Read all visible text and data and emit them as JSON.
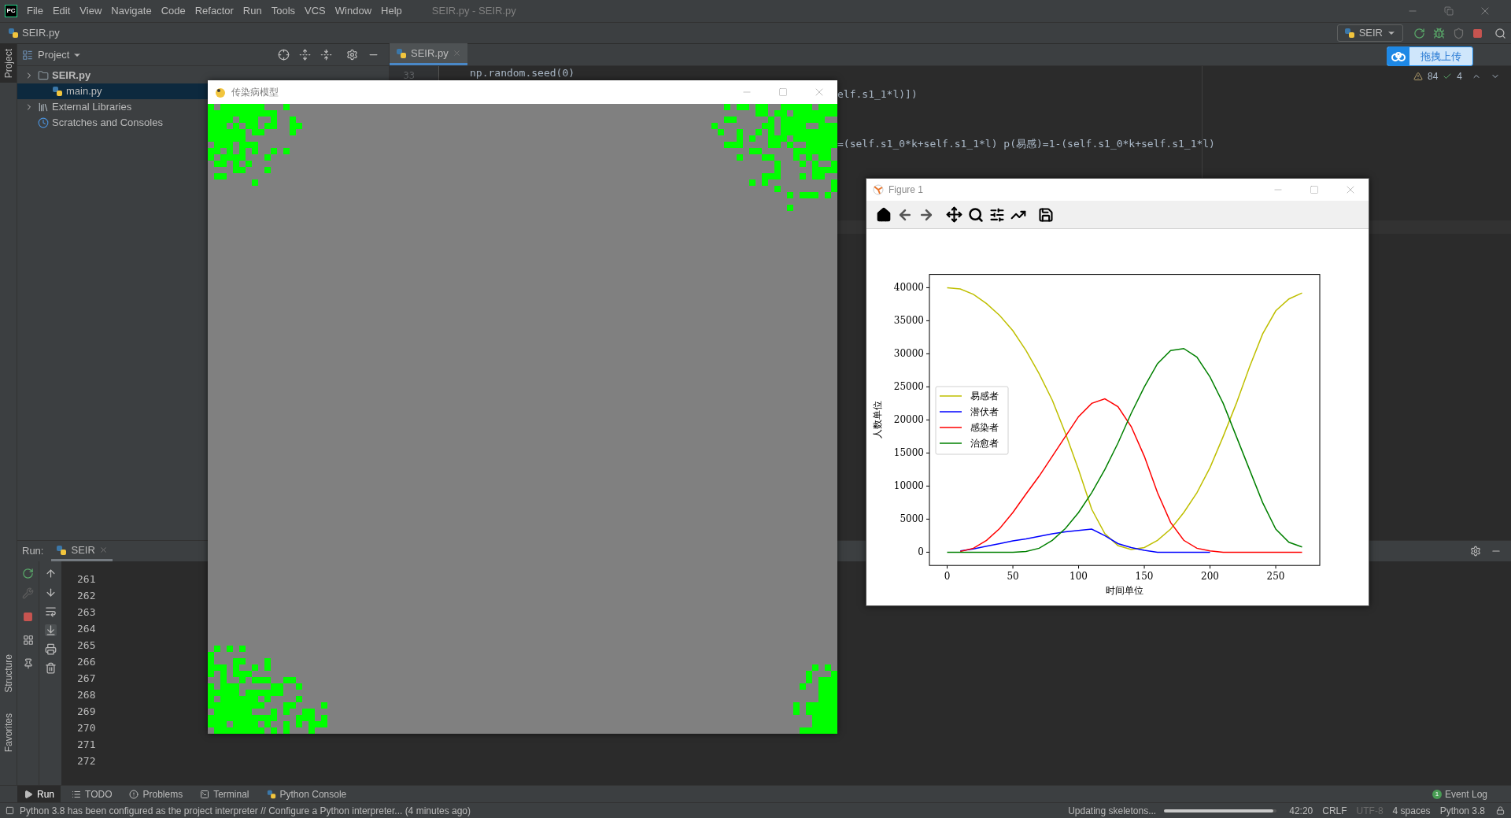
{
  "menu_bar": {
    "logo": "PC",
    "items": [
      "File",
      "Edit",
      "View",
      "Navigate",
      "Code",
      "Refactor",
      "Run",
      "Tools",
      "VCS",
      "Window",
      "Help"
    ],
    "title": "SEIR.py - SEIR.py"
  },
  "nav_bar": {
    "breadcrumb": "SEIR.py",
    "run_config": "SEIR"
  },
  "upload_button": "拖拽上传",
  "side_tabs": [
    {
      "label": "Project",
      "selected": true
    },
    {
      "label": "Structure",
      "selected": false
    },
    {
      "label": "Favorites",
      "selected": false
    }
  ],
  "project_panel": {
    "title": "Project",
    "tree": [
      {
        "label": "SEIR.py",
        "kind": "folder",
        "expanded": false,
        "selected": false
      },
      {
        "label": "main.py",
        "kind": "python",
        "selected": true
      },
      {
        "label": "External Libraries",
        "kind": "library",
        "expanded": false,
        "selected": false
      },
      {
        "label": "Scratches and Consoles",
        "kind": "scratch",
        "selected": false
      }
    ]
  },
  "editor": {
    "tab": "SEIR.py",
    "line_number": "33",
    "code": "np.random.seed(0)",
    "fragments": [
      "elf.s1_1*l)])",
      "=(self.s1_0*k+self.s1_1*l) p(易感)=1-(self.s1_0*k+self.s1_1*l)"
    ],
    "warnings": "84",
    "checks": "4"
  },
  "game_window": {
    "title": "传染病模型"
  },
  "figure_window": {
    "title": "Figure 1",
    "chart_data": {
      "type": "line",
      "xlabel": "时间单位",
      "ylabel": "人数单位",
      "x": [
        0,
        10,
        20,
        30,
        40,
        50,
        60,
        70,
        80,
        90,
        100,
        110,
        120,
        130,
        140,
        150,
        160,
        170,
        180,
        190,
        200,
        210,
        220,
        230,
        240,
        250,
        260,
        270
      ],
      "xlim": [
        -13.5,
        283.5
      ],
      "ylim": [
        -2000,
        42000
      ],
      "xticks": [
        0,
        50,
        100,
        150,
        200,
        250
      ],
      "yticks": [
        0,
        5000,
        10000,
        15000,
        20000,
        25000,
        30000,
        35000,
        40000
      ],
      "legend": true,
      "series": [
        {
          "name": "易感者",
          "color": "#bfbf00",
          "values": [
            40000,
            39800,
            39000,
            37600,
            35800,
            33500,
            30500,
            27000,
            23000,
            18000,
            12500,
            6500,
            2800,
            1000,
            400,
            700,
            1800,
            3500,
            6000,
            9000,
            12800,
            17500,
            22500,
            28000,
            33000,
            36500,
            38300,
            39200
          ]
        },
        {
          "name": "潜伏者",
          "color": "#0000ff",
          "values": [
            null,
            200,
            500,
            900,
            1300,
            1700,
            2000,
            2400,
            2800,
            3100,
            3300,
            3500,
            2500,
            1300,
            700,
            300,
            0,
            0,
            0,
            0,
            0,
            null,
            null,
            null,
            null,
            null,
            null,
            null
          ]
        },
        {
          "name": "感染者",
          "color": "#ff0000",
          "values": [
            null,
            100,
            600,
            1800,
            3600,
            6000,
            8800,
            11500,
            14500,
            17500,
            20500,
            22500,
            23200,
            22000,
            19000,
            14500,
            9000,
            4500,
            1800,
            600,
            200,
            0,
            0,
            0,
            0,
            0,
            0,
            0
          ]
        },
        {
          "name": "治愈者",
          "color": "#008000",
          "values": [
            0,
            0,
            0,
            0,
            0,
            0,
            100,
            600,
            1800,
            3600,
            6000,
            9000,
            12500,
            16500,
            21000,
            25000,
            28500,
            30500,
            30800,
            29500,
            26500,
            22500,
            17500,
            12500,
            7500,
            3500,
            1500,
            800
          ]
        }
      ]
    }
  },
  "run_panel": {
    "label": "Run:",
    "tab": "SEIR",
    "lines": [
      "261",
      "262",
      "263",
      "264",
      "265",
      "266",
      "267",
      "268",
      "269",
      "270",
      "271",
      "272"
    ]
  },
  "tool_tabs": [
    {
      "label": "Run",
      "kind": "run",
      "selected": true
    },
    {
      "label": "TODO",
      "kind": "todo",
      "selected": false
    },
    {
      "label": "Problems",
      "kind": "problems",
      "selected": false
    },
    {
      "label": "Terminal",
      "kind": "terminal",
      "selected": false
    },
    {
      "label": "Python Console",
      "kind": "console",
      "selected": false
    }
  ],
  "event_log": {
    "label": "Event Log",
    "badge": "1"
  },
  "status_bar": {
    "message": "Python 3.8 has been configured as the project interpreter // Configure a Python interpreter... (4 minutes ago)",
    "task": "Updating skeletons...",
    "level": 0.97,
    "items": [
      {
        "text": "42:20",
        "disabled": false
      },
      {
        "text": "CRLF",
        "disabled": false
      },
      {
        "text": "UTF-8",
        "disabled": true
      },
      {
        "text": "4 spaces",
        "disabled": false
      },
      {
        "text": "Python 3.8",
        "disabled": false
      }
    ]
  }
}
